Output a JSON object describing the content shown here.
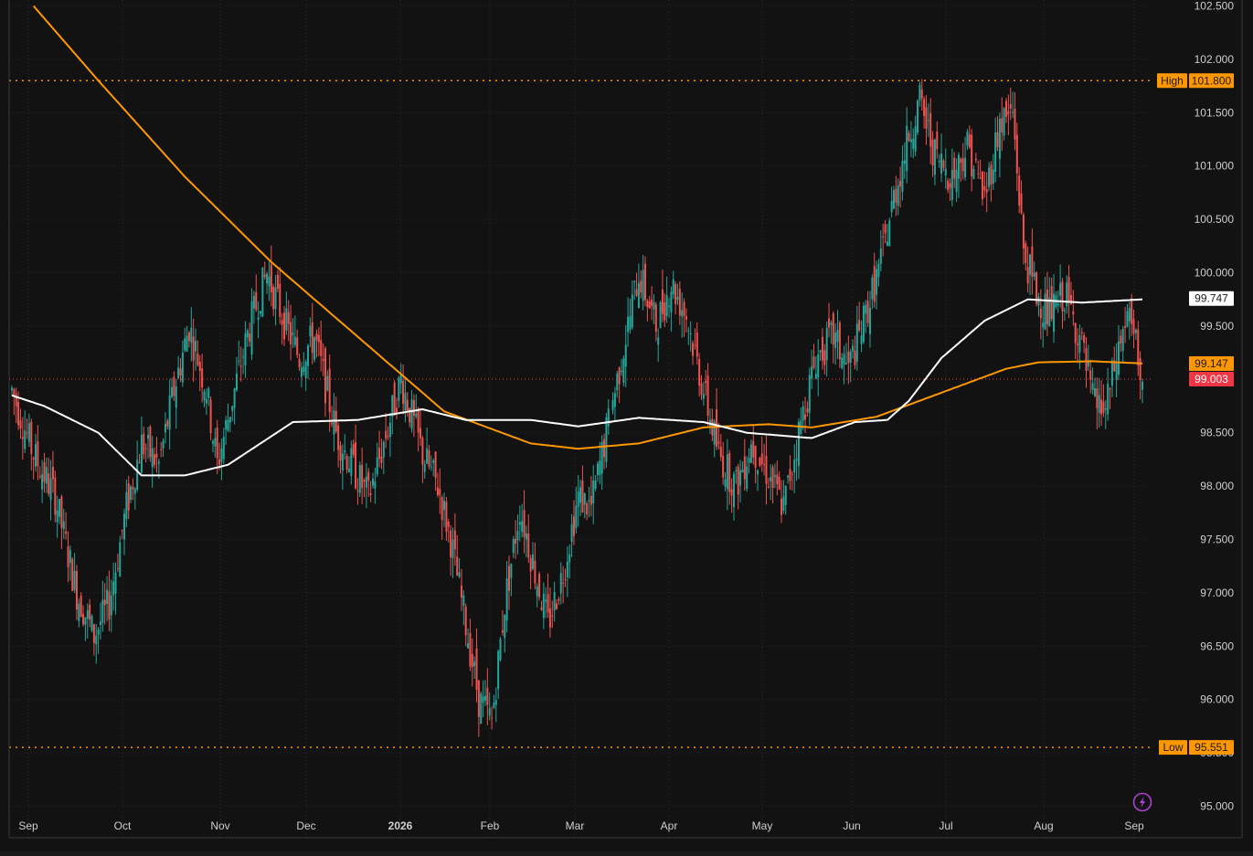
{
  "chart_data": {
    "type": "candlestick",
    "title": "",
    "xlabel": "",
    "ylabel": "",
    "ylim": [
      95.0,
      102.5
    ],
    "y_ticks": [
      "95.000",
      "95.500",
      "96.000",
      "96.500",
      "97.000",
      "97.500",
      "98.000",
      "98.500",
      "99.000",
      "99.500",
      "100.000",
      "100.500",
      "101.000",
      "101.500",
      "102.000",
      "102.500"
    ],
    "x_labels": [
      {
        "label": "Sep",
        "bold": false
      },
      {
        "label": "Oct",
        "bold": false
      },
      {
        "label": "Nov",
        "bold": false
      },
      {
        "label": "Dec",
        "bold": false
      },
      {
        "label": "2026",
        "bold": true
      },
      {
        "label": "Feb",
        "bold": false
      },
      {
        "label": "Mar",
        "bold": false
      },
      {
        "label": "Apr",
        "bold": false
      },
      {
        "label": "May",
        "bold": false
      },
      {
        "label": "Jun",
        "bold": false
      },
      {
        "label": "Jul",
        "bold": false
      },
      {
        "label": "Aug",
        "bold": false
      },
      {
        "label": "Sep",
        "bold": false
      }
    ],
    "grid": true,
    "colors": {
      "up": "#26a69a",
      "down": "#ef5350",
      "ma_fast": "#ffffff",
      "ma_slow": "#ff9800",
      "high_low": "#ff9800",
      "last_price": "#f23645",
      "background": "#121212",
      "grid": "#2a2a2a",
      "axis_text": "#cfcfcf"
    },
    "high": {
      "label": "High",
      "value": "101.800"
    },
    "low": {
      "label": "Low",
      "value": "95.551"
    },
    "last_price": "99.003",
    "ma_fast_value": "99.747",
    "ma_slow_value": "99.147",
    "icon": "lightning-icon",
    "series_path": [
      [
        0,
        98.9
      ],
      [
        10,
        98.3
      ],
      [
        20,
        97.9
      ],
      [
        30,
        97.0
      ],
      [
        38,
        96.6
      ],
      [
        45,
        96.9
      ],
      [
        53,
        97.8
      ],
      [
        60,
        98.4
      ],
      [
        68,
        98.2
      ],
      [
        75,
        98.9
      ],
      [
        82,
        99.5
      ],
      [
        90,
        98.9
      ],
      [
        95,
        98.2
      ],
      [
        103,
        98.9
      ],
      [
        110,
        99.5
      ],
      [
        118,
        100.0
      ],
      [
        125,
        99.6
      ],
      [
        133,
        99.2
      ],
      [
        140,
        99.4
      ],
      [
        150,
        98.5
      ],
      [
        157,
        98.2
      ],
      [
        165,
        97.9
      ],
      [
        172,
        98.4
      ],
      [
        180,
        99.0
      ],
      [
        190,
        98.3
      ],
      [
        197,
        98.0
      ],
      [
        203,
        97.5
      ],
      [
        210,
        96.7
      ],
      [
        216,
        96.0
      ],
      [
        222,
        95.8
      ],
      [
        228,
        96.9
      ],
      [
        235,
        97.8
      ],
      [
        242,
        97.2
      ],
      [
        248,
        96.7
      ],
      [
        255,
        97.2
      ],
      [
        262,
        97.9
      ],
      [
        268,
        97.8
      ],
      [
        275,
        98.5
      ],
      [
        282,
        99.2
      ],
      [
        290,
        100.0
      ],
      [
        298,
        99.5
      ],
      [
        305,
        99.9
      ],
      [
        312,
        99.6
      ],
      [
        320,
        98.9
      ],
      [
        327,
        98.3
      ],
      [
        335,
        98.0
      ],
      [
        342,
        98.4
      ],
      [
        350,
        98.1
      ],
      [
        357,
        97.8
      ],
      [
        365,
        98.6
      ],
      [
        372,
        99.2
      ],
      [
        380,
        99.4
      ],
      [
        387,
        99.1
      ],
      [
        395,
        99.6
      ],
      [
        402,
        100.1
      ],
      [
        408,
        100.7
      ],
      [
        415,
        101.3
      ],
      [
        420,
        101.6
      ],
      [
        427,
        101.1
      ],
      [
        435,
        100.9
      ],
      [
        442,
        101.2
      ],
      [
        450,
        100.7
      ],
      [
        457,
        101.4
      ],
      [
        463,
        101.5
      ],
      [
        468,
        100.2
      ],
      [
        474,
        99.8
      ],
      [
        480,
        99.6
      ],
      [
        487,
        99.8
      ],
      [
        494,
        99.4
      ],
      [
        500,
        98.8
      ],
      [
        506,
        98.7
      ],
      [
        511,
        99.2
      ],
      [
        516,
        99.6
      ],
      [
        520,
        99.3
      ],
      [
        523,
        99.0
      ]
    ],
    "ma_fast_path": [
      [
        0,
        98.85
      ],
      [
        15,
        98.75
      ],
      [
        40,
        98.5
      ],
      [
        60,
        98.1
      ],
      [
        80,
        98.1
      ],
      [
        100,
        98.2
      ],
      [
        130,
        98.6
      ],
      [
        160,
        98.62
      ],
      [
        190,
        98.72
      ],
      [
        210,
        98.62
      ],
      [
        240,
        98.62
      ],
      [
        262,
        98.56
      ],
      [
        290,
        98.64
      ],
      [
        320,
        98.6
      ],
      [
        340,
        98.5
      ],
      [
        370,
        98.45
      ],
      [
        390,
        98.6
      ],
      [
        405,
        98.62
      ],
      [
        415,
        98.8
      ],
      [
        430,
        99.2
      ],
      [
        450,
        99.55
      ],
      [
        470,
        99.75
      ],
      [
        495,
        99.72
      ],
      [
        523,
        99.75
      ]
    ],
    "ma_slow_path": [
      [
        10,
        102.5
      ],
      [
        40,
        101.8
      ],
      [
        80,
        100.9
      ],
      [
        120,
        100.1
      ],
      [
        160,
        99.4
      ],
      [
        200,
        98.7
      ],
      [
        240,
        98.4
      ],
      [
        262,
        98.35
      ],
      [
        290,
        98.4
      ],
      [
        320,
        98.55
      ],
      [
        350,
        98.58
      ],
      [
        370,
        98.55
      ],
      [
        400,
        98.65
      ],
      [
        420,
        98.8
      ],
      [
        440,
        98.95
      ],
      [
        460,
        99.1
      ],
      [
        475,
        99.16
      ],
      [
        500,
        99.17
      ],
      [
        523,
        99.15
      ]
    ]
  }
}
